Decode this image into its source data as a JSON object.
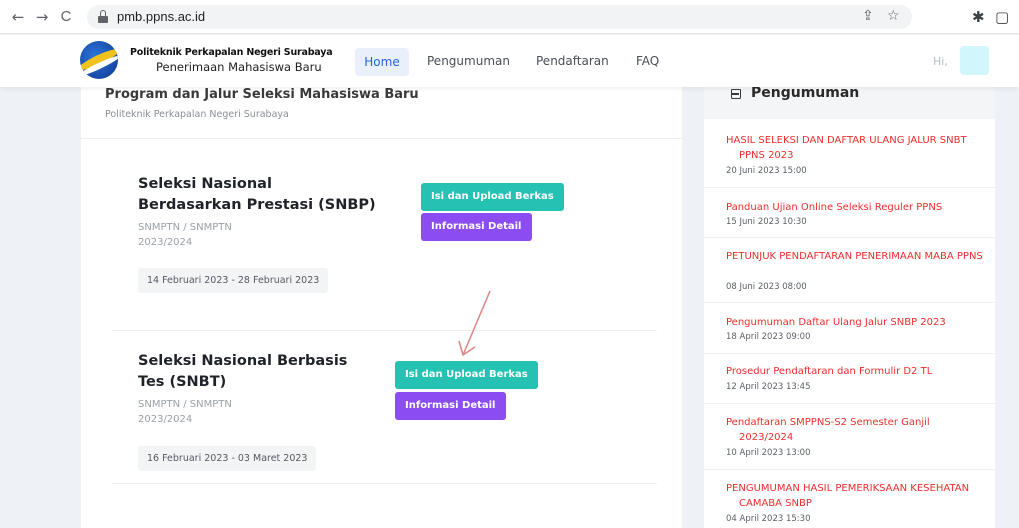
{
  "browser": {
    "back_icon": "←",
    "forward_icon": "→",
    "reload_icon": "C",
    "url": "pmb.ppns.ac.id",
    "share_icon": "⇪",
    "star_icon": "☆",
    "extensions_icon": "✱",
    "sidepanel_icon": "▢"
  },
  "header": {
    "brand_title": "Politeknik Perkapalan Negeri Surabaya",
    "brand_subtitle": "Penerimaan Mahasiswa Baru",
    "nav": [
      "Home",
      "Pengumuman",
      "Pendaftaran",
      "FAQ"
    ],
    "greeting": "Hi,"
  },
  "main": {
    "title": "Program dan Jalur Seleksi Mahasiswa Baru",
    "subtitle": "Politeknik Perkapalan Negeri Surabaya",
    "programs": [
      {
        "name": "Seleksi Nasional Berdasarkan Prestasi (SNBP)",
        "code": "SNMPTN / SNMPTN",
        "year": "2023/2024",
        "dates": "14 Februari 2023 - 28 Februari 2023",
        "upload_label": "Isi dan Upload Berkas",
        "info_label": "Informasi Detail"
      },
      {
        "name": "Seleksi Nasional Berbasis Tes (SNBT)",
        "code": "SNMPTN / SNMPTN",
        "year": "2023/2024",
        "dates": "16 Februari 2023 - 03 Maret 2023",
        "upload_label": "Isi dan Upload Berkas",
        "info_label": "Informasi Detail"
      }
    ],
    "colors": {
      "upload_button": "#25c2b3",
      "info_button": "#8b4df1",
      "annotation_arrow": "#d98a8a"
    }
  },
  "side": {
    "title": "Pengumuman",
    "items": [
      {
        "title": "HASIL SELEKSI DAN DAFTAR ULANG JALUR SNBT PPNS 2023",
        "date": "20 Juni 2023 15:00"
      },
      {
        "title": "Panduan Ujian Online Seleksi Reguler PPNS",
        "date": "15 Juni 2023 10:30"
      },
      {
        "title": "PETUNJUK PENDAFTARAN PENERIMAAN MABA PPNS",
        "date": "08 Juni 2023 08:00"
      },
      {
        "title": "Pengumuman Daftar Ulang Jalur SNBP 2023",
        "date": "18 April 2023 09:00"
      },
      {
        "title": "Prosedur Pendaftaran dan Formulir D2 TL",
        "date": "12 April 2023 13:45"
      },
      {
        "title": "Pendaftaran SMPPNS-S2 Semester Ganjil 2023/2024",
        "date": "10 April 2023 13:00"
      },
      {
        "title": "PENGUMUMAN HASIL PEMERIKSAAN KESEHATAN CAMABA SNBP",
        "date": "04 April 2023 15:30"
      }
    ],
    "colors": {
      "announcement_link": "#ee2d2d"
    }
  }
}
